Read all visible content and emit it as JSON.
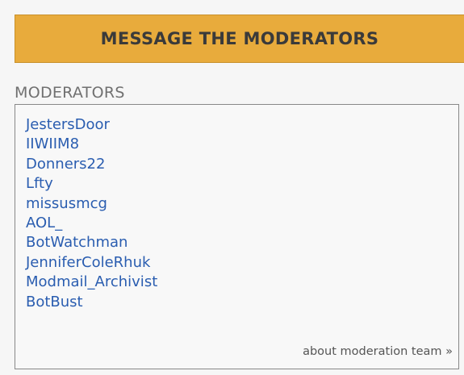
{
  "message_button": {
    "label": "MESSAGE THE MODERATORS"
  },
  "moderators": {
    "heading": "MODERATORS",
    "items": [
      "JestersDoor",
      "IIWIIM8",
      "Donners22",
      "Lfty",
      "missusmcg",
      "AOL_",
      "BotWatchman",
      "JenniferColeRhuk",
      "Modmail_Archivist",
      "BotBust"
    ],
    "about_link": "about moderation team »"
  },
  "colors": {
    "button_background": "#e8ab3c",
    "link": "#2a5db0",
    "heading": "#707070"
  }
}
